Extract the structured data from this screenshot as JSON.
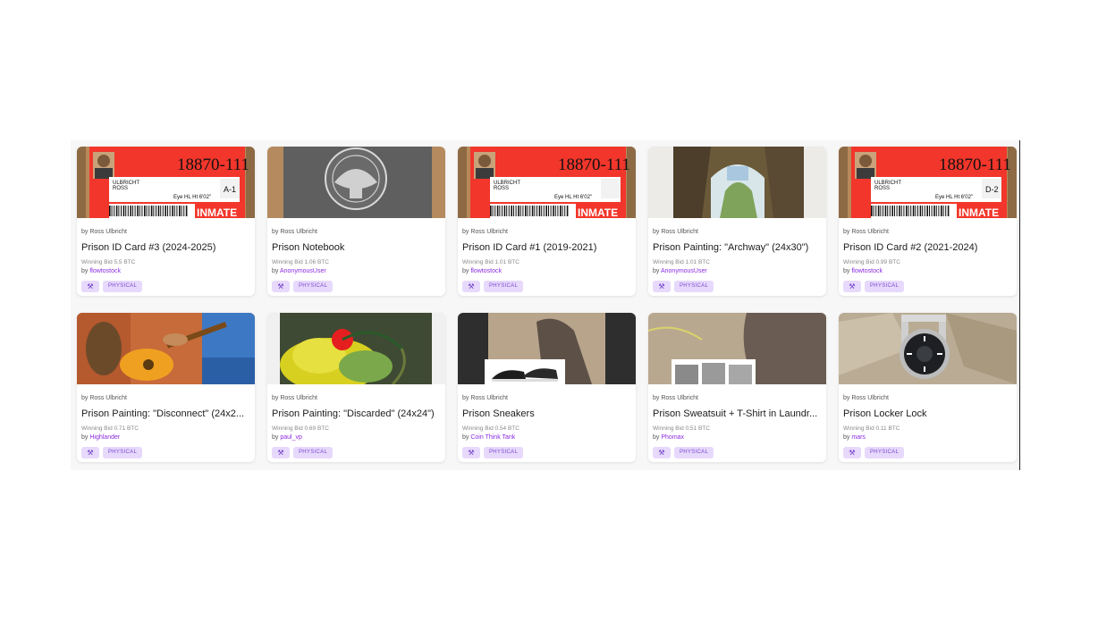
{
  "items": [
    {
      "artist": "by Ross Ulbricht",
      "title": "Prison ID Card #3 (2024-2025)",
      "bid_label": "Winning Bid 5.5 BTC",
      "bidder_prefix": "by",
      "bidder": "flowtostock",
      "badge": "PHYSICAL",
      "art": "idcard",
      "card_text": {
        "number": "18870-111",
        "line1": "ULBRICHT",
        "line2": "ROSS",
        "eye": "Eye HL  Ht 6'02\"",
        "code": "A-1",
        "stamp": "INMATE"
      }
    },
    {
      "artist": "by Ross Ulbricht",
      "title": "Prison Notebook",
      "bid_label": "Winning Bid 1.06 BTC",
      "bidder_prefix": "by",
      "bidder": "AnonymousUser",
      "badge": "PHYSICAL",
      "art": "notebook"
    },
    {
      "artist": "by Ross Ulbricht",
      "title": "Prison ID Card #1 (2019-2021)",
      "bid_label": "Winning Bid 1.01 BTC",
      "bidder_prefix": "by",
      "bidder": "flowtostock",
      "badge": "PHYSICAL",
      "art": "idcard",
      "card_text": {
        "number": "18870-111",
        "line1": "ULBRICHT",
        "line2": "ROSS",
        "eye": "Eye HL  Ht 6'02\"",
        "code": "",
        "stamp": "INMATE"
      }
    },
    {
      "artist": "by Ross Ulbricht",
      "title": "Prison Painting: \"Archway\" (24x30\")",
      "bid_label": "Winning Bid 1.01 BTC",
      "bidder_prefix": "by",
      "bidder": "AnonymousUser",
      "badge": "PHYSICAL",
      "art": "archway"
    },
    {
      "artist": "by Ross Ulbricht",
      "title": "Prison ID Card #2 (2021-2024)",
      "bid_label": "Winning Bid 0.99 BTC",
      "bidder_prefix": "by",
      "bidder": "flowtostock",
      "badge": "PHYSICAL",
      "art": "idcard",
      "card_text": {
        "number": "18870-111",
        "line1": "ULBRICHT",
        "line2": "ROSS",
        "eye": "Eye HL  Ht 6'02\"",
        "code": "D-2",
        "stamp": "INMATE"
      }
    },
    {
      "artist": "by Ross Ulbricht",
      "title": "Prison Painting: \"Disconnect\" (24x2...",
      "bid_label": "Winning Bid 0.71 BTC",
      "bidder_prefix": "by",
      "bidder": "Highlander",
      "badge": "PHYSICAL",
      "art": "guitar"
    },
    {
      "artist": "by Ross Ulbricht",
      "title": "Prison Painting: \"Discarded\" (24x24\")",
      "bid_label": "Winning Bid 0.69 BTC",
      "bidder_prefix": "by",
      "bidder": "paul_vp",
      "badge": "PHYSICAL",
      "art": "flower"
    },
    {
      "artist": "by Ross Ulbricht",
      "title": "Prison Sneakers",
      "bid_label": "Winning Bid 0.54 BTC",
      "bidder_prefix": "by",
      "bidder": "Coin Think Tank",
      "badge": "PHYSICAL",
      "art": "sneakers"
    },
    {
      "artist": "by Ross Ulbricht",
      "title": "Prison Sweatsuit + T-Shirt in Laundr...",
      "bid_label": "Winning Bid 0.51 BTC",
      "bidder_prefix": "by",
      "bidder": "Phomax",
      "badge": "PHYSICAL",
      "art": "sweatsuit"
    },
    {
      "artist": "by Ross Ulbricht",
      "title": "Prison Locker Lock",
      "bid_label": "Winning Bid 0.11 BTC",
      "bidder_prefix": "by",
      "bidder": "mars",
      "badge": "PHYSICAL",
      "art": "lock"
    }
  ],
  "colors": {
    "accent": "#8a2be2",
    "badge_bg": "#e7d9fb",
    "idcard_red": "#f2362b"
  },
  "icons": {
    "auction": "gavel-icon"
  }
}
